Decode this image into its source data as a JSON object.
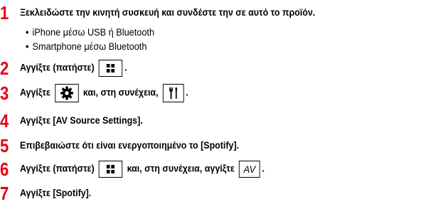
{
  "steps": [
    {
      "num": "1",
      "text": "Ξεκλειδώστε την κινητή συσκευή και συνδέστε την σε αυτό το προϊόν."
    },
    {
      "num": "2",
      "text": "Αγγίξτε (πατήστε)",
      "after": "."
    },
    {
      "num": "3",
      "text": "Αγγίξτε",
      "middle": "και, στη συνέχεια,",
      "after": "."
    },
    {
      "num": "4",
      "text": "Αγγίξτε [AV Source Settings]."
    },
    {
      "num": "5",
      "text": "Επιβεβαιώστε ότι είναι ενεργοποιημένο το [Spotify]."
    },
    {
      "num": "6",
      "text": "Αγγίξτε (πατήστε)",
      "middle": "και, στη συνέχεια, αγγίξτε",
      "after": "."
    },
    {
      "num": "7",
      "text": "Αγγίξτε [Spotify]."
    }
  ],
  "bullets": [
    "iPhone μέσω USB ή Bluetooth",
    "Smartphone μέσω Bluetooth"
  ],
  "bullet_char": "•",
  "icons": {
    "menu": "grid-menu-icon",
    "settings": "gear-icon",
    "system": "tools-icon",
    "av_label": "AV"
  },
  "colors": {
    "step_number": "#e60012"
  }
}
